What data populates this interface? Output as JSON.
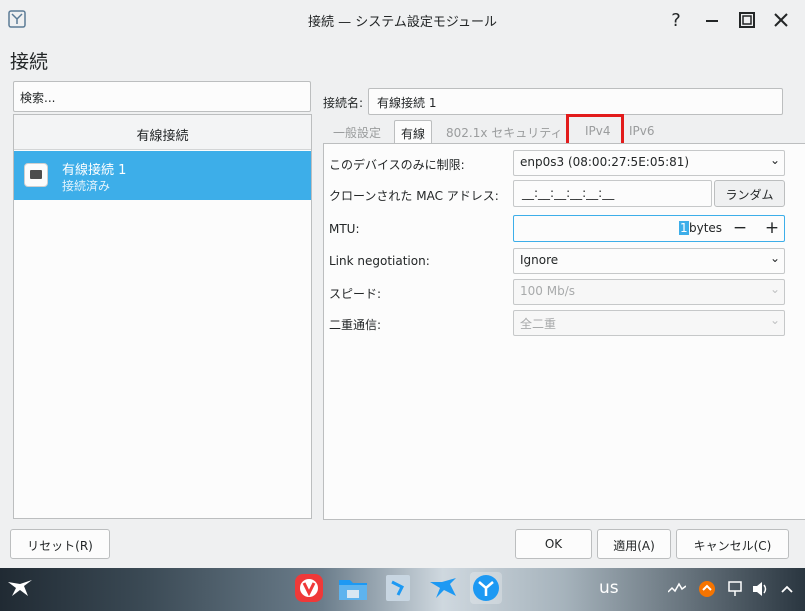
{
  "window": {
    "title": "接続 — システム設定モジュール",
    "help_glyph": "?",
    "minimize_glyph": "–",
    "close_glyph": "✕"
  },
  "page": {
    "heading": "接続"
  },
  "search": {
    "placeholder": "検索..."
  },
  "connections": {
    "group_header": "有線接続",
    "items": [
      {
        "name": "有線接続 1",
        "status": "接続済み",
        "selected": true
      }
    ]
  },
  "editor": {
    "connection_name_label": "接続名:",
    "connection_name_value": "有線接続 1",
    "tabs": [
      {
        "label": "一般設定",
        "active": false
      },
      {
        "label": "有線",
        "active": true
      },
      {
        "label": "802.1x セキュリティ",
        "active": false
      },
      {
        "label": "IPv4",
        "active": false,
        "highlighted": true
      },
      {
        "label": "IPv6",
        "active": false
      }
    ],
    "wired": {
      "restrict_label": "このデバイスのみに制限:",
      "restrict_value": "enp0s3 (08:00:27:5E:05:81)",
      "clone_mac_label": "クローンされた MAC アドレス:",
      "clone_mac_value": "__:__:__:__:__:__",
      "random_button": "ランダム",
      "mtu_label": "MTU:",
      "mtu_value": "1",
      "mtu_unit": "bytes",
      "mtu_minus": "−",
      "mtu_plus": "+",
      "link_neg_label": "Link negotiation:",
      "link_neg_value": "Ignore",
      "speed_label": "スピード:",
      "speed_value": "100 Mb/s",
      "duplex_label": "二重通信:",
      "duplex_value": "全二重"
    }
  },
  "buttons": {
    "reset": "リセット(R)",
    "ok": "OK",
    "apply": "適用(A)",
    "cancel": "キャンセル(C)"
  },
  "taskbar": {
    "keyboard_layout": "us",
    "apps": [
      "start-menu",
      "vivaldi",
      "file-manager",
      "package-manager",
      "discover",
      "system-settings"
    ]
  },
  "colors": {
    "accent": "#3daee9",
    "highlight_box": "#e21b1b",
    "window_bg": "#eff0f1"
  }
}
